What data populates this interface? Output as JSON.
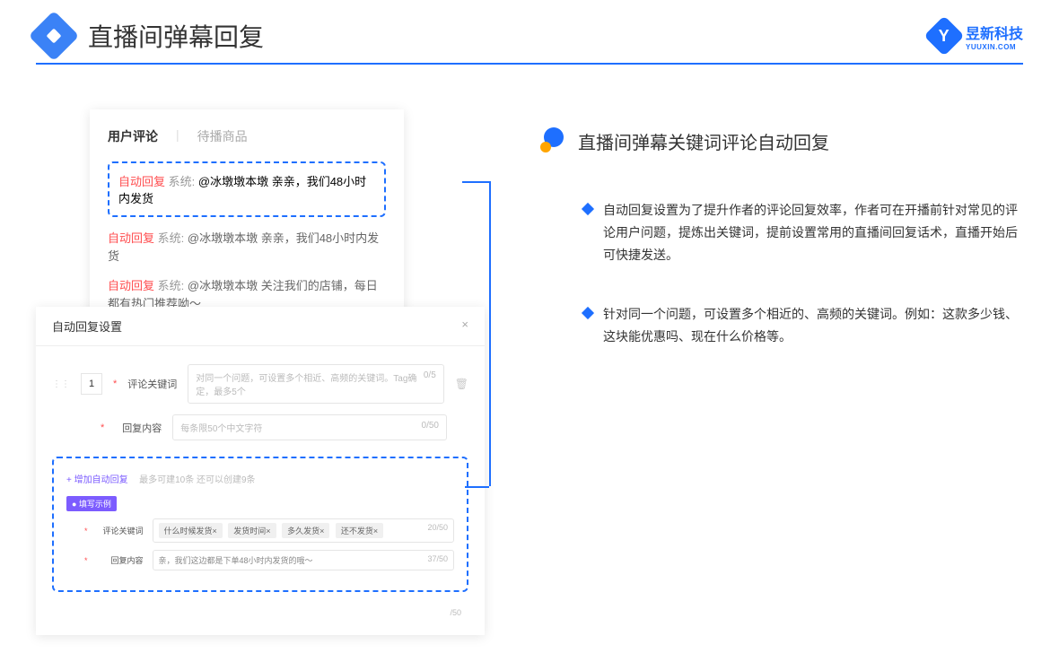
{
  "header": {
    "page_title": "直播间弹幕回复",
    "brand_name": "昱新科技",
    "brand_sub": "YUUXIN.COM",
    "brand_letter": "Y"
  },
  "comment_card": {
    "tab_active": "用户评论",
    "tab_inactive": "待播商品",
    "highlight": {
      "auto": "自动回复",
      "sys": "系统:",
      "text": "@冰墩墩本墩 亲亲，我们48小时内发货"
    },
    "rows": [
      {
        "auto": "自动回复",
        "sys": "系统:",
        "text": "@冰墩墩本墩 亲亲，我们48小时内发货"
      },
      {
        "auto": "自动回复",
        "sys": "系统:",
        "text": "@冰墩墩本墩 关注我们的店铺，每日都有热门推荐呦～"
      }
    ]
  },
  "settings": {
    "title": "自动回复设置",
    "index": "1",
    "keyword_label": "评论关键词",
    "keyword_placeholder": "对同一个问题，可设置多个相近、高频的关键词。Tag确定，最多5个",
    "keyword_counter": "0/5",
    "content_label": "回复内容",
    "content_placeholder": "每条限50个中文字符",
    "content_counter": "0/50",
    "add_link": "+ 增加自动回复",
    "add_hint": "最多可建10条 还可以创建9条",
    "example_badge": "● 填写示例",
    "ex_keyword_label": "评论关键词",
    "ex_tags": [
      "什么时候发货×",
      "发货时间×",
      "多久发货×",
      "还不发货×"
    ],
    "ex_keyword_counter": "20/50",
    "ex_content_label": "回复内容",
    "ex_content_value": "亲，我们这边都是下单48小时内发货的哦～",
    "ex_content_counter": "37/50",
    "outer_counter": "/50"
  },
  "info": {
    "title": "直播间弹幕关键词评论自动回复",
    "bullets": [
      "自动回复设置为了提升作者的评论回复效率，作者可在开播前针对常见的评论用户问题，提炼出关键词，提前设置常用的直播间回复话术，直播开始后可快捷发送。",
      "针对同一个问题，可设置多个相近的、高频的关键词。例如：这款多少钱、这块能优惠吗、现在什么价格等。"
    ]
  }
}
